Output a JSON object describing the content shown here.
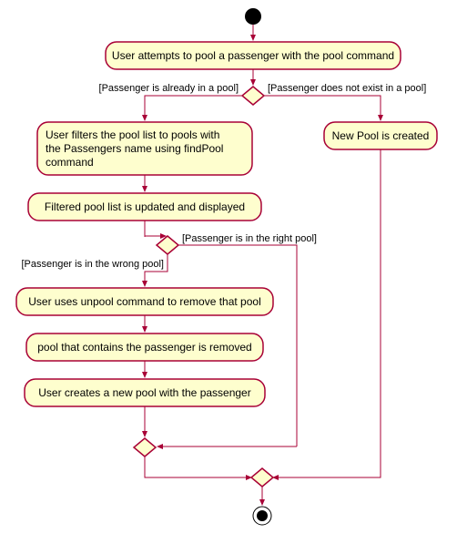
{
  "nodes": {
    "attempt": "User attempts to pool a passenger with the pool command",
    "filter_l1": "User filters the pool list to pools with",
    "filter_l2": "the Passengers name using findPool",
    "filter_l3": "command",
    "filtered": "Filtered pool list is updated and displayed",
    "unpool": "User uses unpool command to remove that pool",
    "removed": "pool that contains the passenger is removed",
    "create_new": "User creates a new pool with the passenger",
    "new_pool": "New Pool is created"
  },
  "guards": {
    "already_in": "[Passenger is already in a pool]",
    "not_exist": "[Passenger does not exist in a pool]",
    "right_pool": "[Passenger is in the right pool]",
    "wrong_pool": "[Passenger is in the wrong pool]"
  },
  "chart_data": {
    "type": "activity-diagram",
    "start": "start",
    "end": "end",
    "activities": [
      {
        "id": "attempt",
        "label": "User attempts to pool a passenger with the pool command"
      },
      {
        "id": "filter",
        "label": "User filters the pool list to pools with the Passengers name using findPool command"
      },
      {
        "id": "filtered",
        "label": "Filtered pool list is updated and displayed"
      },
      {
        "id": "unpool",
        "label": "User uses unpool command to remove that pool"
      },
      {
        "id": "removed",
        "label": "pool that contains the passenger is removed"
      },
      {
        "id": "create_new",
        "label": "User creates a new pool with the passenger"
      },
      {
        "id": "new_pool",
        "label": "New Pool is created"
      }
    ],
    "decisions": [
      {
        "id": "d1",
        "branches": [
          {
            "guard": "[Passenger is already in a pool]",
            "target": "filter"
          },
          {
            "guard": "[Passenger does not exist in a pool]",
            "target": "new_pool"
          }
        ]
      },
      {
        "id": "d2",
        "branches": [
          {
            "guard": "[Passenger is in the right pool]",
            "target": "merge1"
          },
          {
            "guard": "[Passenger is in the wrong pool]",
            "target": "unpool"
          }
        ]
      }
    ],
    "flow": [
      "start -> attempt",
      "attempt -> d1",
      "d1[already in pool] -> filter",
      "d1[not in pool] -> new_pool",
      "filter -> filtered",
      "filtered -> d2",
      "d2[right pool] -> merge1",
      "d2[wrong pool] -> unpool",
      "unpool -> removed",
      "removed -> create_new",
      "create_new -> merge1",
      "merge1 -> merge2",
      "new_pool -> merge2",
      "merge2 -> end"
    ]
  }
}
